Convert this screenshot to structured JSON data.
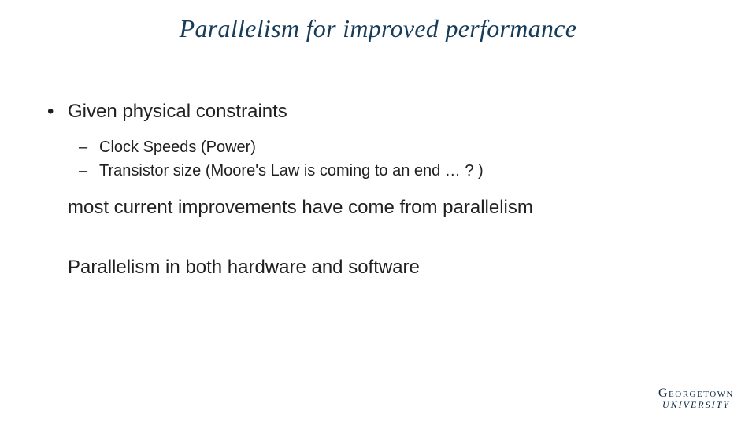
{
  "title": "Parallelism for improved performance",
  "bullet1": "Given physical constraints",
  "sub1": "Clock Speeds (Power)",
  "sub2": "Transistor size (Moore's Law is coming to an end … ? )",
  "cont1": "most current improvements have come from parallelism",
  "cont2": "Parallelism in both hardware and software",
  "logo": {
    "line1": "Georgetown",
    "line2": "UNIVERSITY"
  }
}
